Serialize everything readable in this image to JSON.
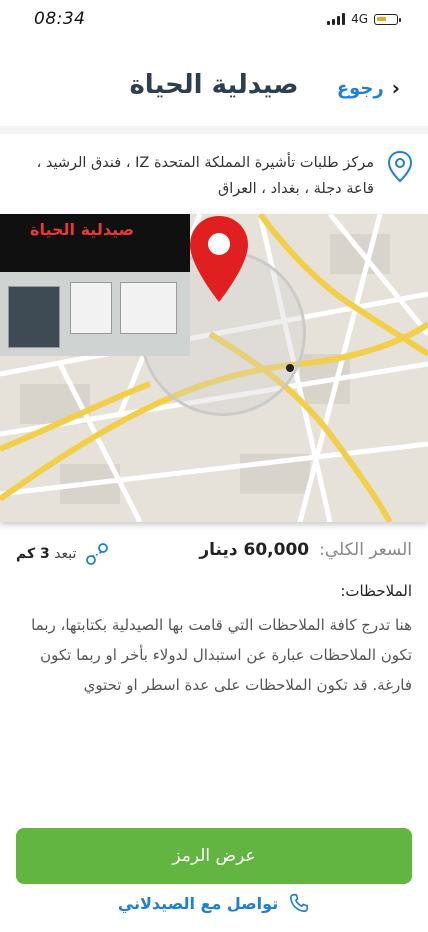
{
  "status_bar": {
    "time": "08:34",
    "network": "4G"
  },
  "header": {
    "back_label": "رجوع",
    "title": "صيدلية الحياة"
  },
  "address": {
    "line1": "مركز طلبات تأشيرة المملكة المتحدة IZ ، فندق الرشيد ،",
    "line2": "قاعة دجلة ، بغداد ، العراق"
  },
  "map": {
    "shop_sign": "صيدلية الحياة"
  },
  "details": {
    "distance_prefix": "تبعد",
    "distance_value": "3 كم",
    "price_label": "السعر الكلي:",
    "price_value": "60,000 دينار"
  },
  "notes": {
    "title": "الملاحظات:",
    "body": "هنا تدرج كافة الملاحظات التي قامت بها الصيدلية بكتابتها، ربما تكون الملاحظات عبارة عن استبدال لدولاء بأخر او ربما تكون فارغة. قد تكون الملاحظات على عدة اسطر او تحتوي"
  },
  "actions": {
    "show_code": "عرض الرمز",
    "contact_pharmacist": "تواصل مع الصيدلاني"
  },
  "colors": {
    "accent_blue": "#1e7fd6",
    "primary_green": "#62b541",
    "marker_red": "#e02020"
  }
}
